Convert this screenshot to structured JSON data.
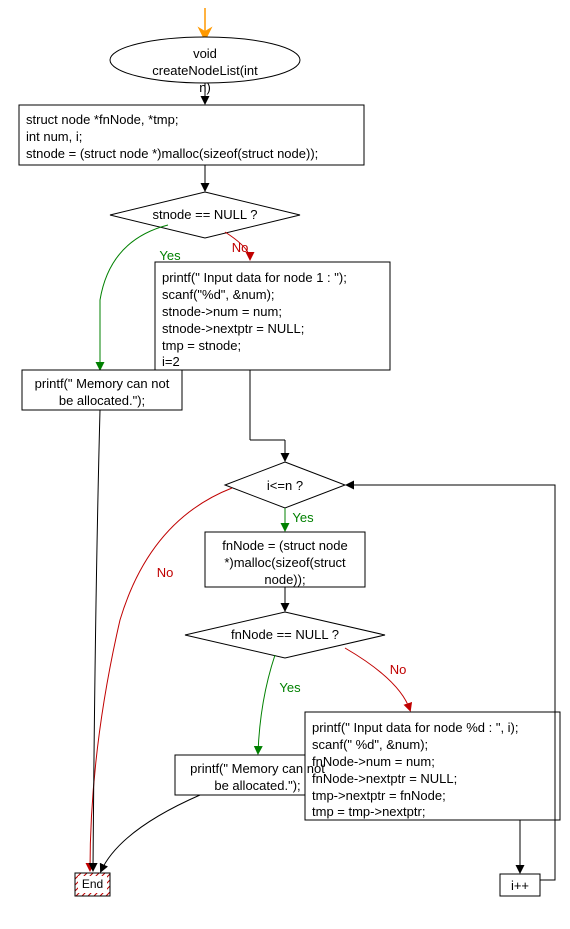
{
  "chart_data": {
    "type": "flowchart",
    "title": "void createNodeList(int n)",
    "nodes": [
      {
        "id": "start_arrow",
        "type": "start"
      },
      {
        "id": "func",
        "type": "terminator",
        "text": "void createNodeList(int n)"
      },
      {
        "id": "decl",
        "type": "process",
        "text": "struct node *fnNode, *tmp;\nint num, i;\nstnode = (struct node *)malloc(sizeof(struct node));"
      },
      {
        "id": "cond1",
        "type": "decision",
        "text": "stnode == NULL ?"
      },
      {
        "id": "memfail1",
        "type": "process",
        "text": "printf(\" Memory can not be allocated.\");"
      },
      {
        "id": "input1",
        "type": "process",
        "text": "printf(\" Input data for node 1 : \");\nscanf(\"%d\", &num);\nstnode->num = num;\nstnode->nextptr = NULL;\ntmp = stnode;\ni=2"
      },
      {
        "id": "cond2",
        "type": "decision",
        "text": "i<=n ?"
      },
      {
        "id": "alloc2",
        "type": "process",
        "text": "fnNode = (struct node *)malloc(sizeof(struct node));"
      },
      {
        "id": "cond3",
        "type": "decision",
        "text": "fnNode == NULL ?"
      },
      {
        "id": "memfail2",
        "type": "process",
        "text": "printf(\" Memory can not be allocated.\");"
      },
      {
        "id": "input2",
        "type": "process",
        "text": "printf(\" Input data for node %d : \", i);\nscanf(\" %d\", &num);\nfnNode->num = num;\nfnNode->nextptr = NULL;\ntmp->nextptr = fnNode;\ntmp = tmp->nextptr;"
      },
      {
        "id": "incr",
        "type": "process",
        "text": "i++"
      },
      {
        "id": "end",
        "type": "end",
        "text": "End"
      }
    ],
    "edges": [
      {
        "from": "start_arrow",
        "to": "func"
      },
      {
        "from": "func",
        "to": "decl"
      },
      {
        "from": "decl",
        "to": "cond1"
      },
      {
        "from": "cond1",
        "to": "memfail1",
        "label": "Yes"
      },
      {
        "from": "cond1",
        "to": "input1",
        "label": "No"
      },
      {
        "from": "input1",
        "to": "cond2"
      },
      {
        "from": "cond2",
        "to": "alloc2",
        "label": "Yes"
      },
      {
        "from": "cond2",
        "to": "end",
        "label": "No"
      },
      {
        "from": "alloc2",
        "to": "cond3"
      },
      {
        "from": "cond3",
        "to": "memfail2",
        "label": "Yes"
      },
      {
        "from": "cond3",
        "to": "input2",
        "label": "No"
      },
      {
        "from": "input2",
        "to": "incr"
      },
      {
        "from": "incr",
        "to": "cond2"
      },
      {
        "from": "memfail1",
        "to": "end"
      },
      {
        "from": "memfail2",
        "to": "end"
      }
    ]
  },
  "labels": {
    "func": "void createNodeList(int\nn)",
    "decl": "struct node *fnNode, *tmp;\nint num, i;\nstnode = (struct node *)malloc(sizeof(struct node));",
    "cond1": "stnode == NULL ?",
    "yes1": "Yes",
    "no1": "No",
    "memfail1": "printf(\" Memory can not\nbe allocated.\");",
    "input1": "printf(\" Input data for node 1 : \");\nscanf(\"%d\", &num);\nstnode->num = num;\nstnode->nextptr = NULL;\ntmp = stnode;\ni=2",
    "cond2": "i<=n ?",
    "yes2": "Yes",
    "no2": "No",
    "alloc2": "fnNode = (struct node\n*)malloc(sizeof(struct\nnode));",
    "cond3": "fnNode == NULL ?",
    "yes3": "Yes",
    "no3": "No",
    "memfail2": "printf(\" Memory can not\nbe allocated.\");",
    "input2": "printf(\" Input data for node %d : \", i);\nscanf(\" %d\", &num);\nfnNode->num = num;\nfnNode->nextptr = NULL;\ntmp->nextptr = fnNode;\ntmp = tmp->nextptr;",
    "incr": "i++",
    "end": "End"
  },
  "colors": {
    "yes": "#008000",
    "no": "#c00000",
    "arrow": "#000",
    "entry": "#ff9900"
  }
}
